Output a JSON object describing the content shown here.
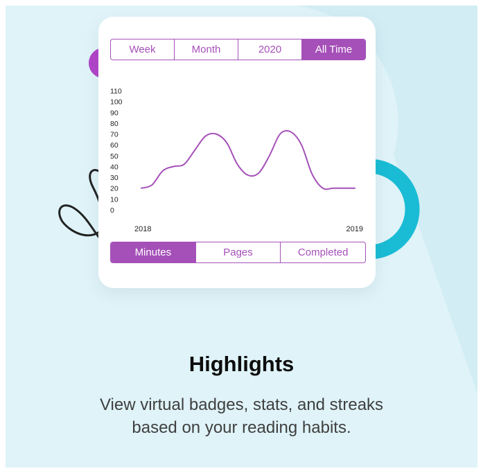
{
  "colors": {
    "accent": "#a550b8",
    "ring": "#19bcd4",
    "background": "#dff3f8"
  },
  "range_tabs": [
    {
      "label": "Week",
      "active": false
    },
    {
      "label": "Month",
      "active": false
    },
    {
      "label": "2020",
      "active": false
    },
    {
      "label": "All Time",
      "active": true
    }
  ],
  "metric_tabs": [
    {
      "label": "Minutes",
      "active": true
    },
    {
      "label": "Pages",
      "active": false
    },
    {
      "label": "Completed",
      "active": false
    }
  ],
  "chart_data": {
    "type": "line",
    "y_ticks": [
      0,
      10,
      20,
      30,
      40,
      50,
      60,
      70,
      80,
      90,
      100,
      110
    ],
    "ylim": [
      0,
      110
    ],
    "x_labels": [
      "2018",
      "2019"
    ],
    "grid": false,
    "series": [
      {
        "values": [
          20,
          23,
          36,
          40,
          42,
          55,
          68,
          70,
          62,
          42,
          32,
          34,
          50,
          70,
          72,
          60,
          33,
          20,
          20,
          20,
          20
        ]
      }
    ]
  },
  "headline": "Highlights",
  "subtitle": {
    "line1": "View virtual badges, stats, and streaks",
    "line2": "based on your reading habits."
  }
}
